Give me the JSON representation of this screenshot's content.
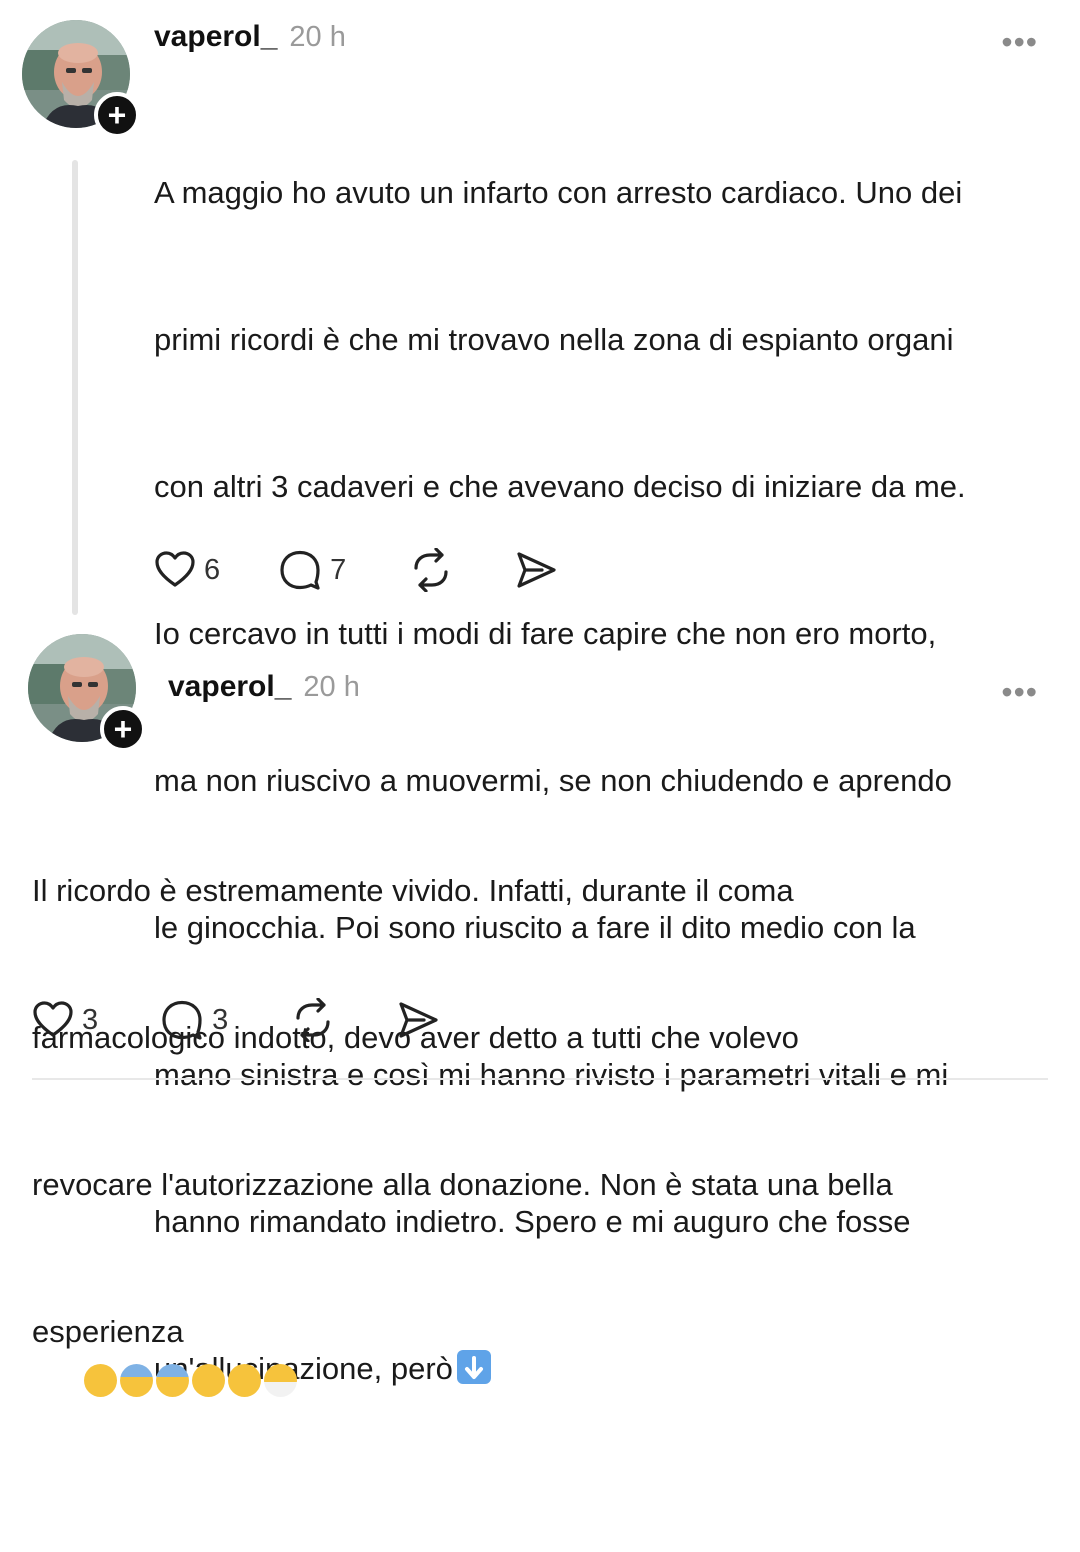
{
  "posts": [
    {
      "username": "vaperol_",
      "time": "20 h",
      "text_lines": [
        "A maggio ho avuto un infarto con arresto cardiaco. Uno dei",
        "primi ricordi è che mi trovavo nella zona di espianto organi",
        "con altri 3 cadaveri e che avevano deciso di iniziare da me.",
        "Io cercavo in tutti i modi di fare capire che non ero morto,",
        "ma non riuscivo a muovermi, se non chiudendo e aprendo",
        "le ginocchia. Poi sono riuscito a fare il dito medio con la",
        "mano sinistra e così mi hanno rivisto i parametri vitali e mi",
        "hanno rimandato indietro. Spero e mi auguro che fosse",
        "un'allucinazione, però"
      ],
      "trailing_emoji": "down-arrow-button-emoji",
      "likes": "6",
      "replies": "7",
      "more_label": "•••",
      "follow_label": "+"
    },
    {
      "username": "vaperol_",
      "time": "20 h",
      "text_lines": [
        "Il ricordo è estremamente vivido. Infatti, durante il coma",
        "farmacologico indotto, devo aver detto a tutti che volevo",
        "revocare l'autorizzazione alla donazione. Non è stata una bella",
        "esperienza"
      ],
      "trailing_emojis": [
        "thinking-face-emoji",
        "fearful-face-emoji",
        "fearful-face-emoji",
        "astonished-face-emoji",
        "flushed-face-emoji",
        "face-with-medical-mask-emoji"
      ],
      "likes": "3",
      "replies": "3",
      "more_label": "•••",
      "follow_label": "+"
    }
  ],
  "icons": {
    "like": "heart-icon",
    "reply": "comment-icon",
    "repost": "repost-icon",
    "share": "send-icon"
  },
  "colors": {
    "text": "#1a1a1a",
    "muted": "#9a9a9a",
    "thread_line": "#e4e4e4",
    "badge": "#111111"
  }
}
